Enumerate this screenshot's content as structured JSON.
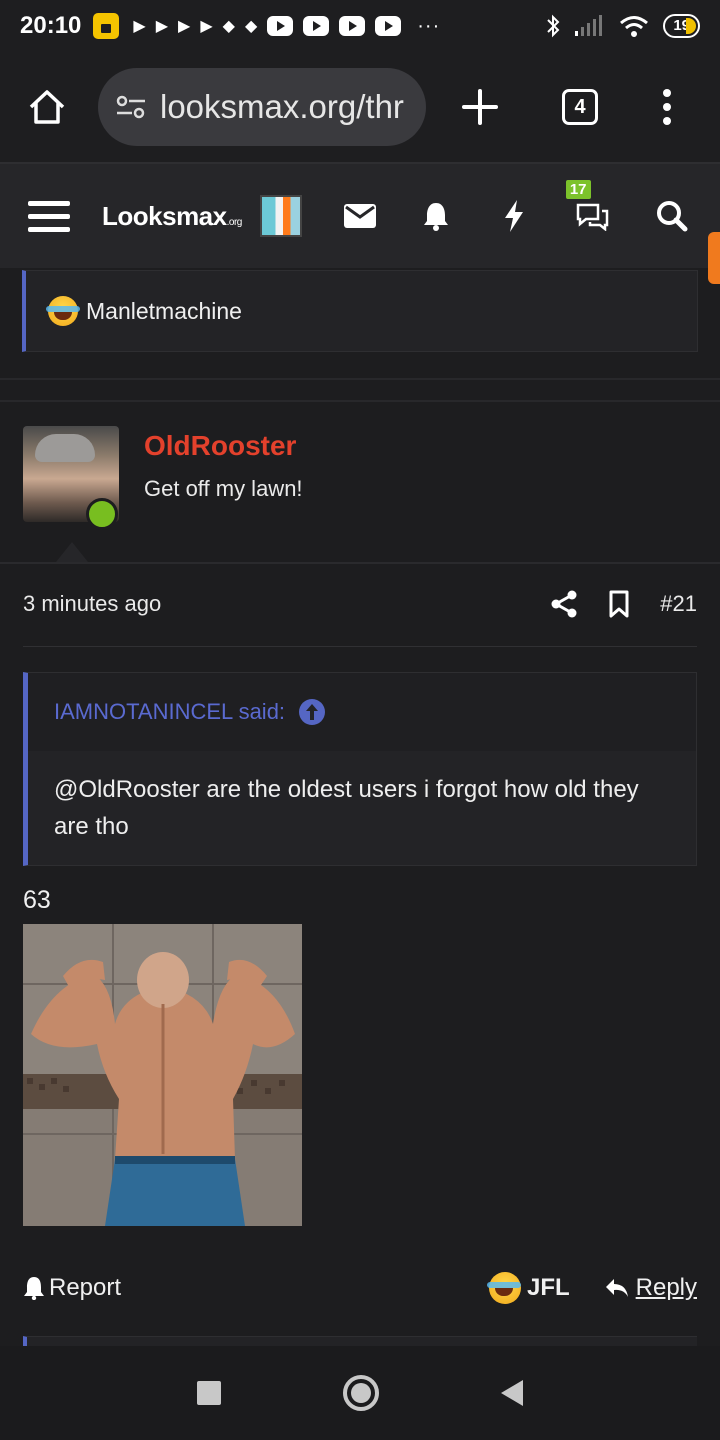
{
  "status_bar": {
    "time": "20:10",
    "battery": "19"
  },
  "browser": {
    "url": "looksmax.org/thr",
    "tab_count": "4"
  },
  "site": {
    "logo": "Looksmax",
    "logo_suffix": ".org",
    "chat_badge": "17"
  },
  "prev_quote": {
    "text": "Manletmachine",
    "emoji": "laughing-crying-emoji"
  },
  "post": {
    "username": "OldRooster",
    "user_title": "Get off my lawn!",
    "time": "3 minutes ago",
    "post_number": "#21",
    "quote_author": "IAMNOTANINCEL said:",
    "quote_text": "@OldRooster are the oldest users i forgot how old they are tho",
    "body_text": "63",
    "actions": {
      "report": "Report",
      "reaction": "JFL",
      "reply": "Reply"
    }
  },
  "colors": {
    "accent_blue": "#5566c4",
    "username_red": "#e3412c",
    "online_green": "#78be20",
    "badge_green": "#7cc22b"
  }
}
